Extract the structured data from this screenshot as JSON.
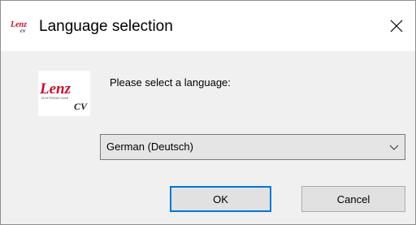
{
  "window": {
    "title": "Language selection",
    "logo_text": "Lenz",
    "logo_sub": "cv"
  },
  "content": {
    "prompt": "Please select a language:",
    "logo_brand": "Lenz",
    "logo_tagline": "ELEKTRONIK GmbH",
    "logo_cv": "CV"
  },
  "language_select": {
    "selected": "German (Deutsch)"
  },
  "buttons": {
    "ok": "OK",
    "cancel": "Cancel"
  },
  "colors": {
    "brand_red": "#c8102e",
    "focus_blue": "#0078d7"
  },
  "icons": {
    "close": "close-icon",
    "dropdown": "chevron-down-icon"
  }
}
